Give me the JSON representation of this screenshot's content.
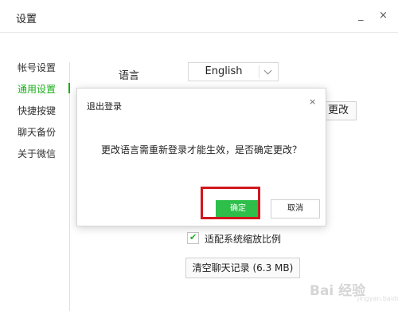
{
  "window": {
    "title": "设置",
    "minimize": "_",
    "close": "×"
  },
  "sidebar": {
    "items": [
      "帐号设置",
      "通用设置",
      "快捷按键",
      "聊天备份",
      "关于微信"
    ],
    "active_index": 1
  },
  "general": {
    "language_label": "语言",
    "language_value": "English",
    "change_button": "更改",
    "scale_checkbox": {
      "label": "适配系统缩放比例",
      "checked": true
    },
    "clear_history_button": "清空聊天记录 (6.3 MB)"
  },
  "dialog": {
    "title": "退出登录",
    "close": "×",
    "message": "更改语言需重新登录才能生效，是否确定更改？",
    "confirm": "确定",
    "cancel": "取消"
  },
  "watermark": {
    "text": "Bai 经验",
    "sub": "jingyan.baidu.com"
  },
  "colors": {
    "accent": "#1aad19",
    "confirm_button": "#2dbf4a",
    "highlight_box": "#d2171e"
  }
}
